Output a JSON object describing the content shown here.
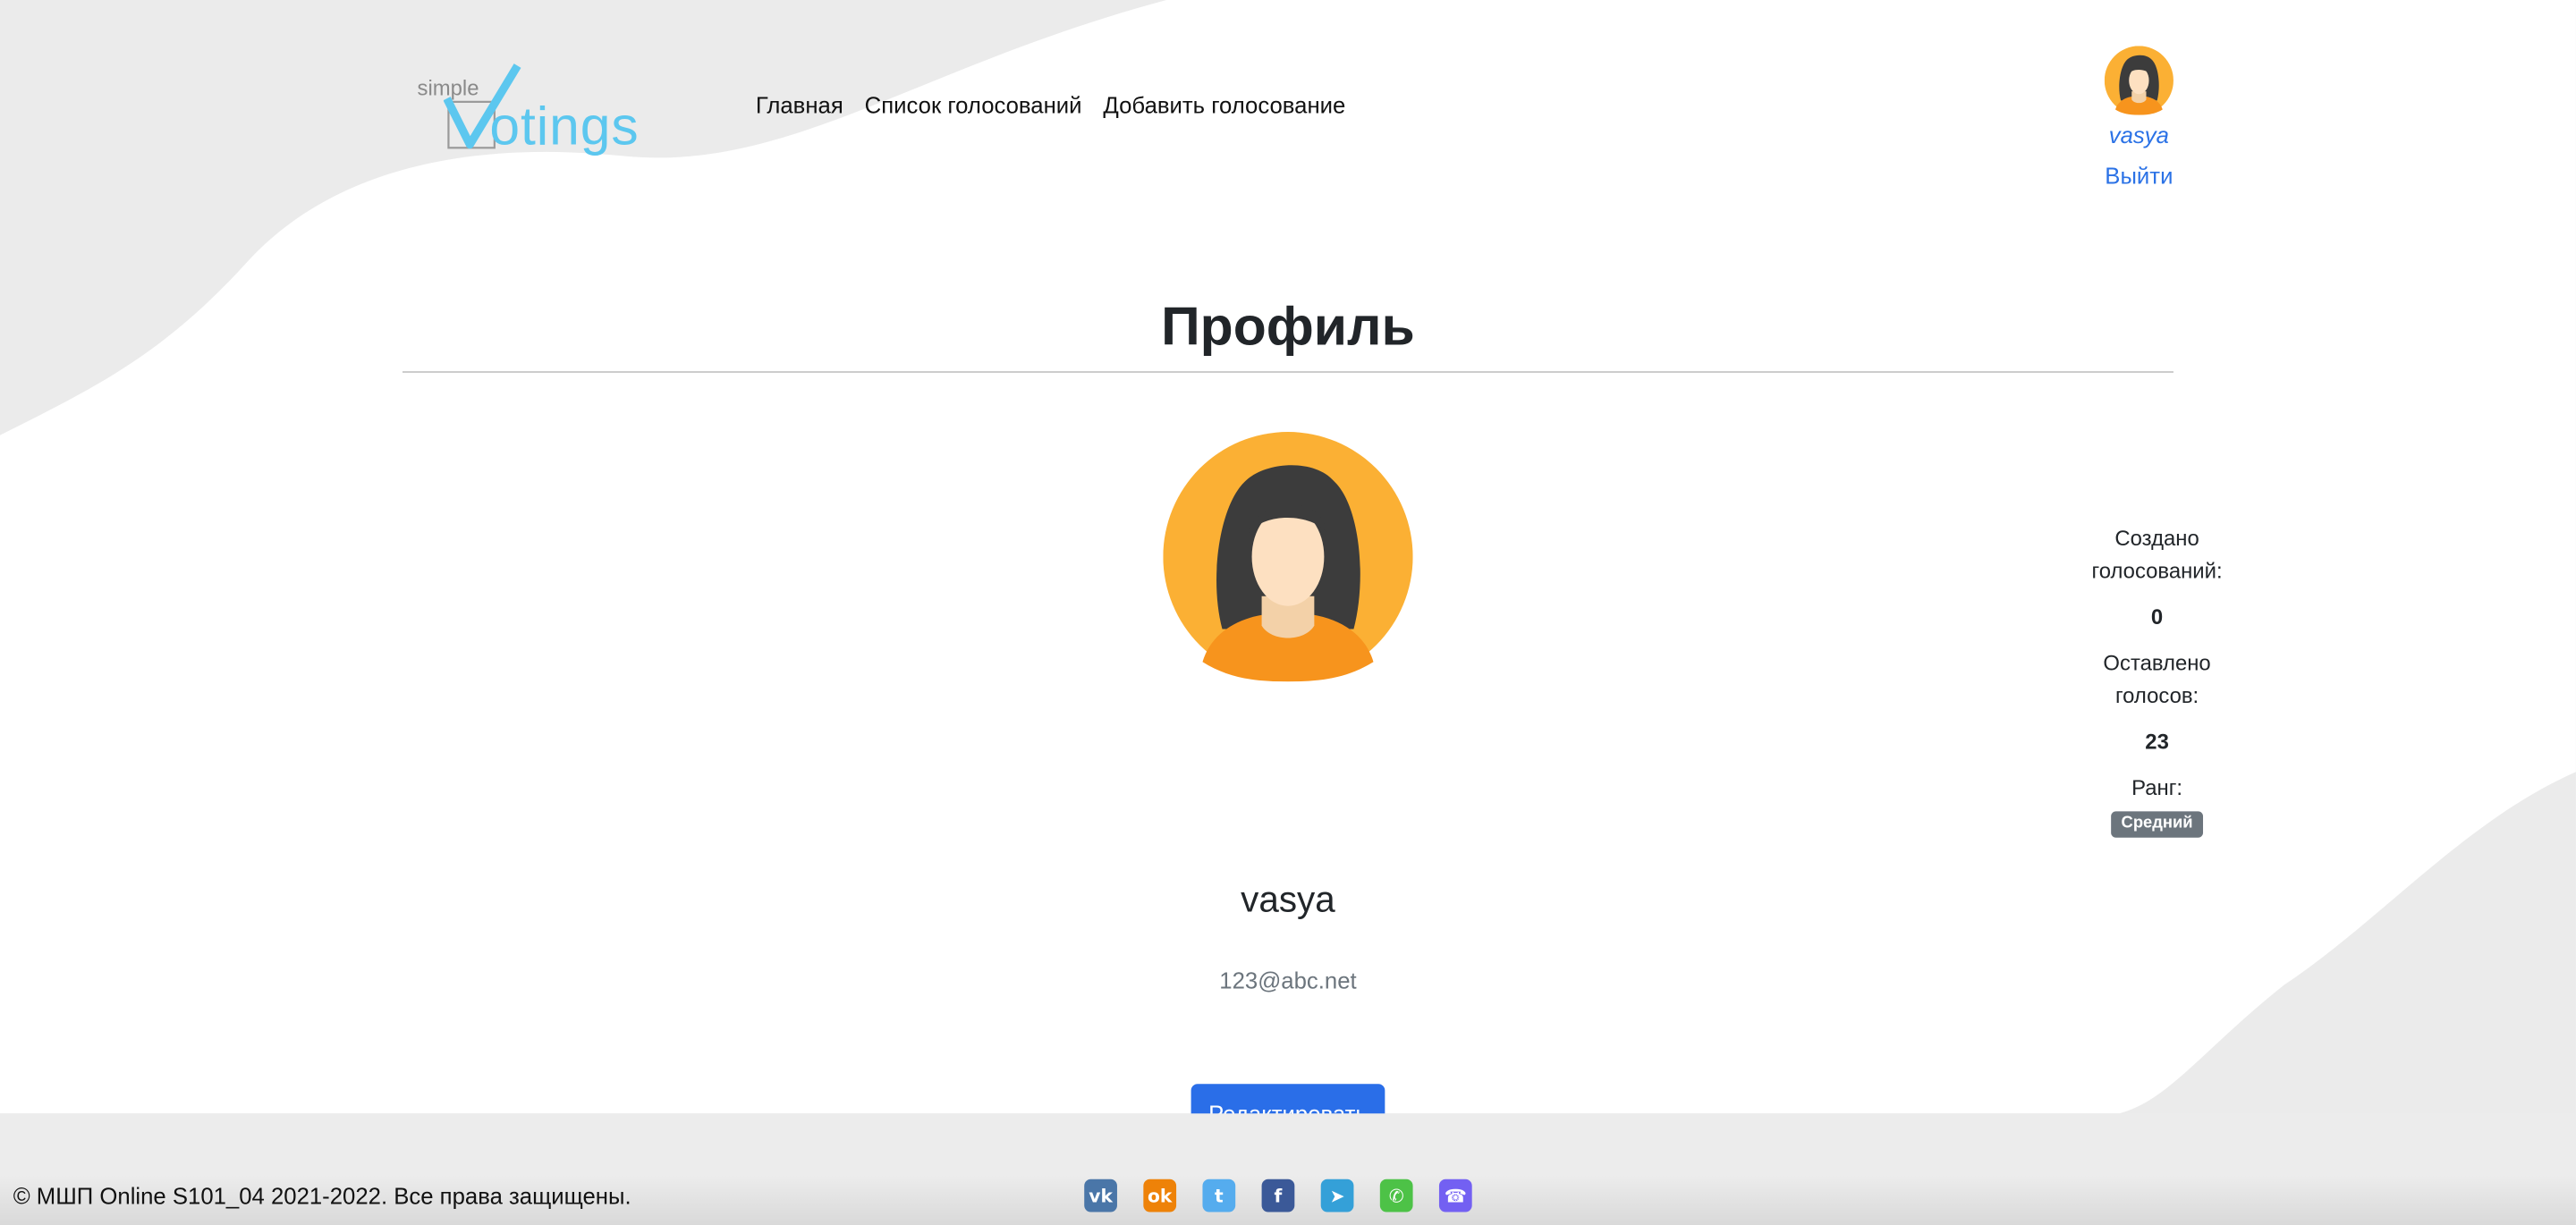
{
  "header": {
    "logo": {
      "small_word": "simple",
      "big_word": "otings",
      "check_letter": "V"
    },
    "nav": [
      {
        "label": "Главная"
      },
      {
        "label": "Список голосований"
      },
      {
        "label": "Добавить голосование"
      }
    ],
    "user": {
      "name": "vasya",
      "logout_label": "Выйти"
    }
  },
  "main": {
    "title": "Профиль",
    "profile": {
      "name": "vasya",
      "email": "123@abc.net",
      "edit_label": "Редактировать"
    },
    "stats": {
      "created_label": "Создано голосований:",
      "created_value": "0",
      "votes_label": "Оставлено голосов:",
      "votes_value": "23",
      "rank_label": "Ранг:",
      "rank_value": "Средний"
    }
  },
  "footer": {
    "copyright": "© МШП Online S101_04 2021-2022. Все права защищены.",
    "socials": [
      {
        "icon": "vk-icon",
        "glyph": "vk",
        "color": "#4a76a8"
      },
      {
        "icon": "odnoklassniki-icon",
        "glyph": "ok",
        "color": "#ee8208"
      },
      {
        "icon": "twitter-icon",
        "glyph": "t",
        "color": "#55acee"
      },
      {
        "icon": "facebook-icon",
        "glyph": "f",
        "color": "#3b5998"
      },
      {
        "icon": "telegram-icon",
        "glyph": "➤",
        "color": "#34a0d8"
      },
      {
        "icon": "whatsapp-icon",
        "glyph": "✆",
        "color": "#4dc247"
      },
      {
        "icon": "viber-icon",
        "glyph": "☎",
        "color": "#7360f2"
      }
    ]
  },
  "colors": {
    "accent": "#2a6ee8",
    "logo_blue": "#5cc7ef",
    "avatar_bg": "#fbb034",
    "badge": "#6c757d"
  }
}
